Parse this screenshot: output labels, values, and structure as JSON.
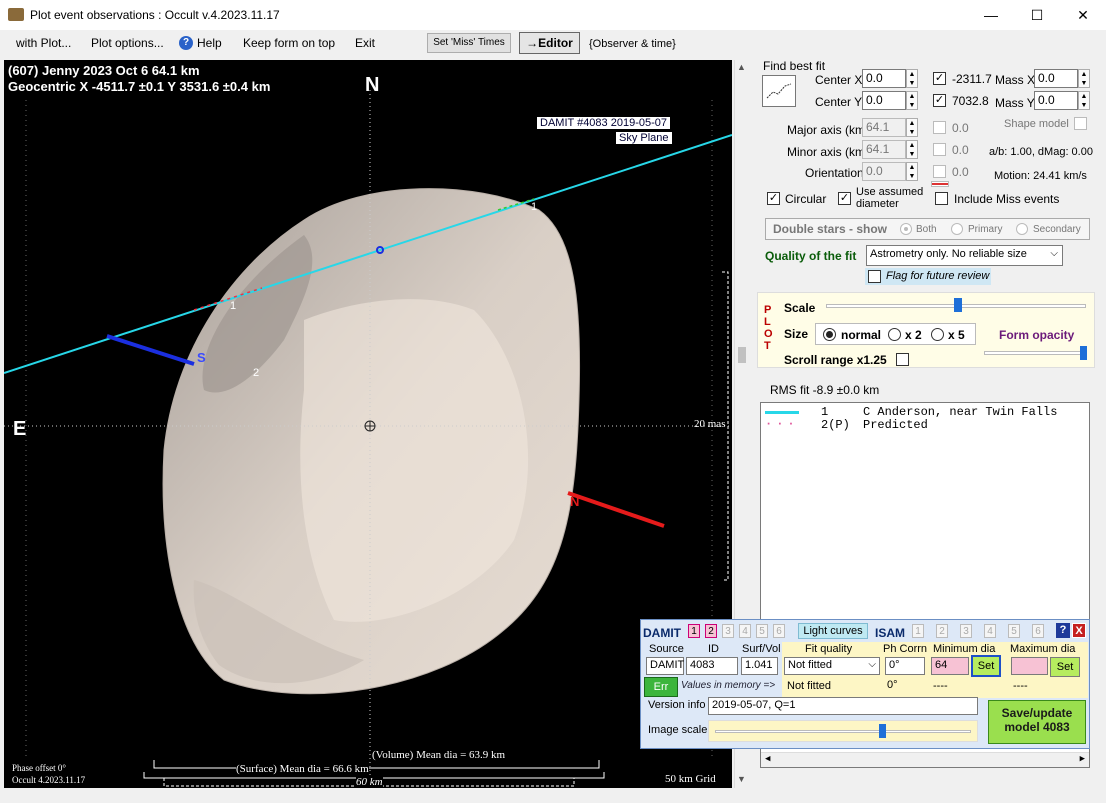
{
  "window": {
    "title": "Plot event observations : Occult v.4.2023.11.17",
    "minimize": "—",
    "maximize": "☐",
    "close": "✕"
  },
  "menu": {
    "with_plot": "with Plot...",
    "plot_options": "Plot options...",
    "help": "Help",
    "keep_form_on_top": "Keep form on top",
    "exit": "Exit",
    "set_miss_times": "Set 'Miss' Times",
    "editor": "→Editor",
    "observer_time": "{Observer & time}"
  },
  "plot": {
    "header_line1": "(607) Jenny  2023 Oct 6   64.1 km",
    "header_line2": "Geocentric  X  -4511.7 ±0.1  Y 3531.6 ±0.4 km",
    "north": "N",
    "east": "E",
    "damit_label": "DAMIT #4083 2019-05-07",
    "sky_plane": "Sky Plane",
    "mas": "20 mas",
    "chord1_label": "1",
    "chord2_label": "2",
    "chord1b_label": "1",
    "s_label": "S",
    "n_label": "N",
    "phase_offset": "Phase offset 0°",
    "version": "Occult 4.2023.11.17",
    "volume_dia": "(Volume) Mean dia = 63.9 km",
    "surface_dia": "(Surface) Mean dia = 66.6 km",
    "scale_km": "60 km",
    "grid": "50 km Grid"
  },
  "fit": {
    "find_best_fit": "Find best fit",
    "center_x_label": "Center X",
    "center_x": "0.0",
    "center_y_label": "Center Y",
    "center_y": "0.0",
    "val1": "-2311.7",
    "val2": "7032.8",
    "mass_x_label": "Mass X",
    "mass_x": "0.0",
    "mass_y_label": "Mass Y",
    "mass_y": "0.0",
    "major_axis_label": "Major axis (km)",
    "major_axis": "64.1",
    "minor_axis_label": "Minor axis (km)",
    "minor_axis": "64.1",
    "orientation_label": "Orientation",
    "orientation": "0.0",
    "zero1": "0.0",
    "zero2": "0.0",
    "zero3": "0.0",
    "shape_model": "Shape model",
    "ab_dmag": "a/b: 1.00, dMag: 0.00",
    "motion": "Motion: 24.41 km/s",
    "circular": "Circular",
    "use_assumed": "Use assumed diameter",
    "include_miss": "Include Miss events",
    "double_stars": "Double stars - show",
    "both": "Both",
    "primary": "Primary",
    "secondary": "Secondary",
    "quality_label": "Quality of the fit",
    "quality_value": "Astrometry only. No reliable size",
    "flag_review": "Flag for future review"
  },
  "plotctl": {
    "plot_vertical": "PLOT",
    "scale": "Scale",
    "size": "Size",
    "normal": "normal",
    "x2": "x 2",
    "x5": "x 5",
    "form_opacity": "Form opacity",
    "scroll_range": "Scroll range x1.25",
    "scale_fraction": 0.5,
    "opacity_fraction": 1.0
  },
  "results": {
    "rms": "RMS fit -8.9 ±0.0 km",
    "rows": [
      {
        "num": "1",
        "name": "C Anderson, near Twin Falls"
      },
      {
        "num": "2(P)",
        "name": "Predicted"
      }
    ]
  },
  "damit": {
    "damit": "DAMIT",
    "tabs": [
      "1",
      "2",
      "3",
      "4",
      "5",
      "6"
    ],
    "light_curves": "Light curves",
    "isam": "ISAM",
    "isam_tabs": [
      "1",
      "2",
      "3",
      "4",
      "5",
      "6"
    ],
    "help": "?",
    "close": "X",
    "source_label": "Source",
    "id_label": "ID",
    "surf_vol_label": "Surf/Vol",
    "fit_quality_label": "Fit quality",
    "ph_corrn_label": "Ph Corrn",
    "min_dia_label": "Minimum dia",
    "max_dia_label": "Maximum dia",
    "source": "DAMIT",
    "id": "4083",
    "surf_vol": "1.041",
    "fit_quality": "Not fitted",
    "ph_corrn": "0°",
    "min_dia": "64",
    "max_dia": "",
    "set": "Set",
    "err": "Err",
    "values_in_memory": "Values in memory =>",
    "not_fitted": "Not fitted",
    "ph_mem": "0°",
    "min_mem": "----",
    "max_mem": "----",
    "version_label": "Version info",
    "version": "2019-05-07, Q=1",
    "image_scale_label": "Image scale",
    "image_scale_fraction": 0.64,
    "save_update": "Save/update model 4083"
  }
}
